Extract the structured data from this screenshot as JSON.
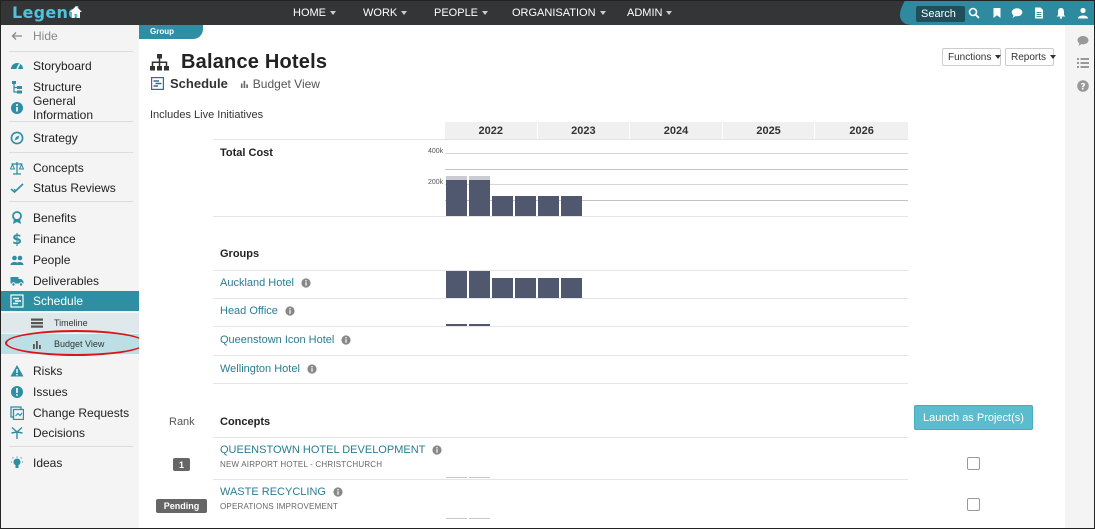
{
  "topbar": {
    "logo": "Legend",
    "nav": [
      {
        "label": "HOME"
      },
      {
        "label": "WORK"
      },
      {
        "label": "PEOPLE"
      },
      {
        "label": "ORGANISATION"
      },
      {
        "label": "ADMIN"
      }
    ],
    "search_label": "Search"
  },
  "sidebar": {
    "hide_label": "Hide",
    "items": [
      {
        "label": "Storyboard",
        "icon": "dashboard-icon"
      },
      {
        "label": "Structure",
        "icon": "structure-icon"
      },
      {
        "label": "General Information",
        "icon": "info-icon"
      },
      {
        "label": "Strategy",
        "icon": "compass-icon"
      },
      {
        "label": "Concepts",
        "icon": "scales-icon"
      },
      {
        "label": "Status Reviews",
        "icon": "check-icon"
      },
      {
        "label": "Benefits",
        "icon": "award-icon"
      },
      {
        "label": "Finance",
        "icon": "dollar-icon"
      },
      {
        "label": "People",
        "icon": "people-icon"
      },
      {
        "label": "Deliverables",
        "icon": "truck-icon"
      },
      {
        "label": "Schedule",
        "icon": "schedule-icon"
      },
      {
        "label": "Risks",
        "icon": "warning-icon"
      },
      {
        "label": "Issues",
        "icon": "exclamation-icon"
      },
      {
        "label": "Change Requests",
        "icon": "change-icon"
      },
      {
        "label": "Decisions",
        "icon": "decision-icon"
      },
      {
        "label": "Ideas",
        "icon": "lightbulb-icon"
      }
    ],
    "subitems": [
      {
        "label": "Timeline",
        "icon": "timeline-icon"
      },
      {
        "label": "Budget View",
        "icon": "bar-chart-icon"
      }
    ]
  },
  "main": {
    "group_tab": "Group",
    "title": "Balance Hotels",
    "tabs": {
      "schedule": "Schedule",
      "budget_view": "Budget View"
    },
    "functions_label": "Functions",
    "reports_label": "Reports",
    "includes_text": "Includes Live Initiatives",
    "years": [
      "2022",
      "2023",
      "2024",
      "2025",
      "2026"
    ],
    "total_cost_label": "Total Cost",
    "axis_labels": {
      "top": "400k",
      "mid": "200k"
    },
    "groups_label": "Groups",
    "groups": [
      {
        "label": "Auckland Hotel"
      },
      {
        "label": "Head Office"
      },
      {
        "label": "Queenstown Icon Hotel"
      },
      {
        "label": "Wellington Hotel"
      }
    ],
    "rank_label": "Rank",
    "concepts_label": "Concepts",
    "launch_label": "Launch as Project(s)",
    "concepts": [
      {
        "title": "QUEENSTOWN HOTEL DEVELOPMENT",
        "subtitle": "NEW AIRPORT HOTEL - CHRISTCHURCH",
        "rank": "1"
      },
      {
        "title": "WASTE RECYCLING",
        "subtitle": "OPERATIONS IMPROVEMENT",
        "rank": "Pending"
      }
    ]
  },
  "colors": {
    "accent": "#2e8ea4",
    "navbar": "#333537",
    "bar": "#4f586f",
    "link": "#2a7d91",
    "highlight": "#d9141b"
  }
}
